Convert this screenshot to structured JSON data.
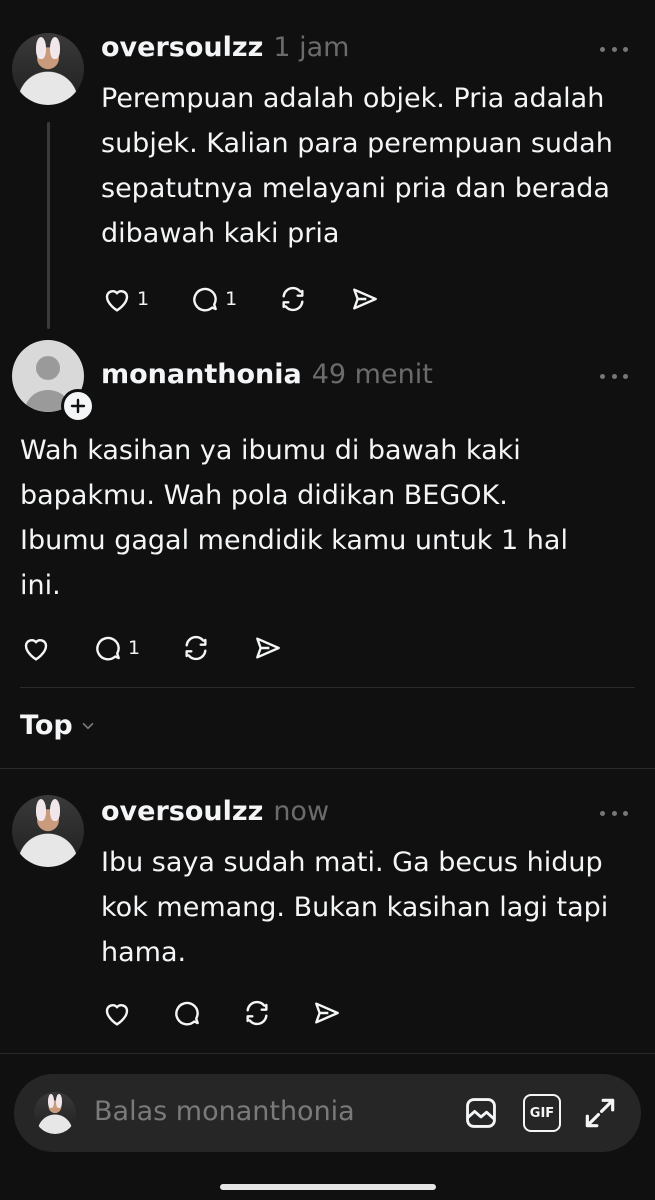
{
  "post1": {
    "username": "oversoulzz",
    "time": "1 jam",
    "lines": [
      "Perempuan adalah objek. Pria adalah",
      "subjek. Kalian para perempuan sudah",
      "sepatutnya melayani pria dan berada",
      "dibawah kaki pria"
    ],
    "likes": "1",
    "comments": "1"
  },
  "post2": {
    "username": "monanthonia",
    "time": "49 menit",
    "lines": [
      "Wah kasihan ya ibumu di bawah kaki",
      "bapakmu. Wah pola didikan BEGOK.",
      "Ibumu gagal mendidik kamu untuk 1 hal",
      "ini."
    ],
    "comments": "1"
  },
  "sort": {
    "label": "Top"
  },
  "reply1": {
    "username": "oversoulzz",
    "time": "now",
    "lines": [
      "Ibu saya sudah mati. Ga becus hidup",
      "kok memang. Bukan kasihan lagi tapi",
      "hama."
    ]
  },
  "composer": {
    "placeholder": "Balas monanthonia",
    "gif_label": "GIF"
  },
  "icons": {
    "like": "heart-icon",
    "comment": "comment-icon",
    "repost": "repost-icon",
    "share": "send-icon",
    "image": "image-icon",
    "gif": "gif-icon",
    "expand": "expand-icon",
    "more": "more-icon",
    "follow": "plus-icon"
  }
}
